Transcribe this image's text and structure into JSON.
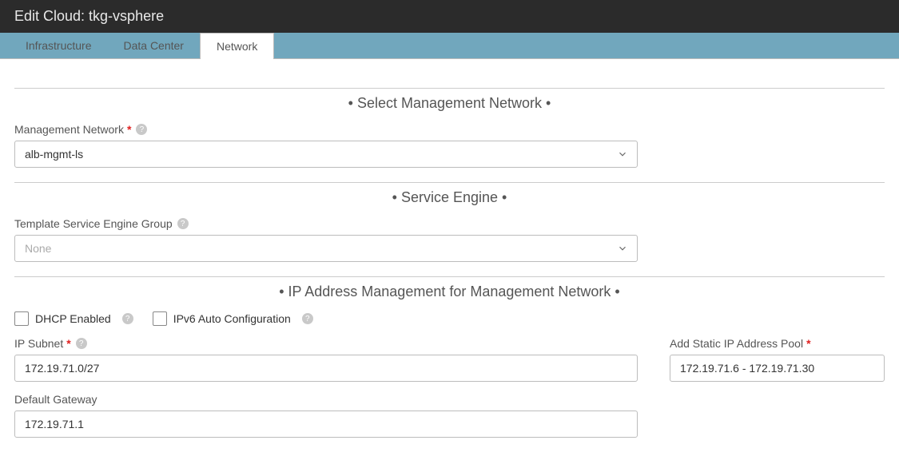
{
  "header": {
    "title": "Edit Cloud: tkg-vsphere"
  },
  "tabs": [
    {
      "label": "Infrastructure",
      "active": false
    },
    {
      "label": "Data Center",
      "active": false
    },
    {
      "label": "Network",
      "active": true
    }
  ],
  "sections": {
    "mgmt_net": {
      "title": "• Select Management Network •",
      "field_label": "Management Network",
      "value": "alb-mgmt-ls"
    },
    "svc_engine": {
      "title": "• Service Engine •",
      "field_label": "Template Service Engine Group",
      "placeholder": "None",
      "value": ""
    },
    "ipam": {
      "title": "• IP Address Management for Management Network •",
      "dhcp_label": "DHCP Enabled",
      "ipv6_label": "IPv6 Auto Configuration",
      "subnet_label": "IP Subnet",
      "subnet_value": "172.19.71.0/27",
      "pool_label": "Add Static IP Address Pool",
      "pool_value": "172.19.71.6 - 172.19.71.30",
      "gw_label": "Default Gateway",
      "gw_value": "172.19.71.1"
    }
  }
}
